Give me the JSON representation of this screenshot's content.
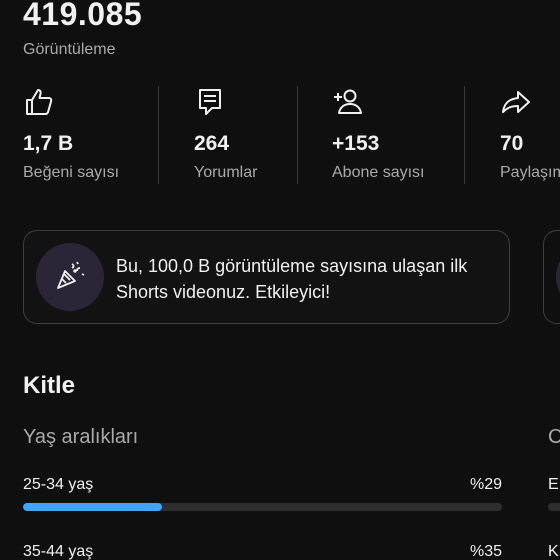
{
  "overview": {
    "views_value": "419.085",
    "views_label": "Görüntüleme"
  },
  "stats": [
    {
      "icon": "thumbs-up-icon",
      "value": "1,7 B",
      "label": "Beğeni sayısı"
    },
    {
      "icon": "comment-icon",
      "value": "264",
      "label": "Yorumlar"
    },
    {
      "icon": "person-add-icon",
      "value": "+153",
      "label": "Abone sayısı"
    },
    {
      "icon": "share-icon",
      "value": "70",
      "label": "Paylaşım"
    }
  ],
  "milestone_card": {
    "icon": "party-popper-icon",
    "text": "Bu, 100,0 B görüntüleme sayısına ulaşan ilk Shorts videonuz. Etkileyici!"
  },
  "audience": {
    "title": "Kitle",
    "age_section_title": "Yaş aralıkları",
    "second_section_title": "C",
    "age_rows": [
      {
        "label": "25-34 yaş",
        "percent_text": "%29",
        "fraction": 0.29
      },
      {
        "label": "35-44 yaş",
        "percent_text": "%35",
        "fraction": 0.35
      }
    ],
    "second_rows": [
      {
        "label": "E"
      },
      {
        "label": "K"
      }
    ]
  },
  "colors": {
    "background": "#0f0f0f",
    "accent_bar": "#3ea6ff",
    "badge_bg": "#2a2638"
  }
}
